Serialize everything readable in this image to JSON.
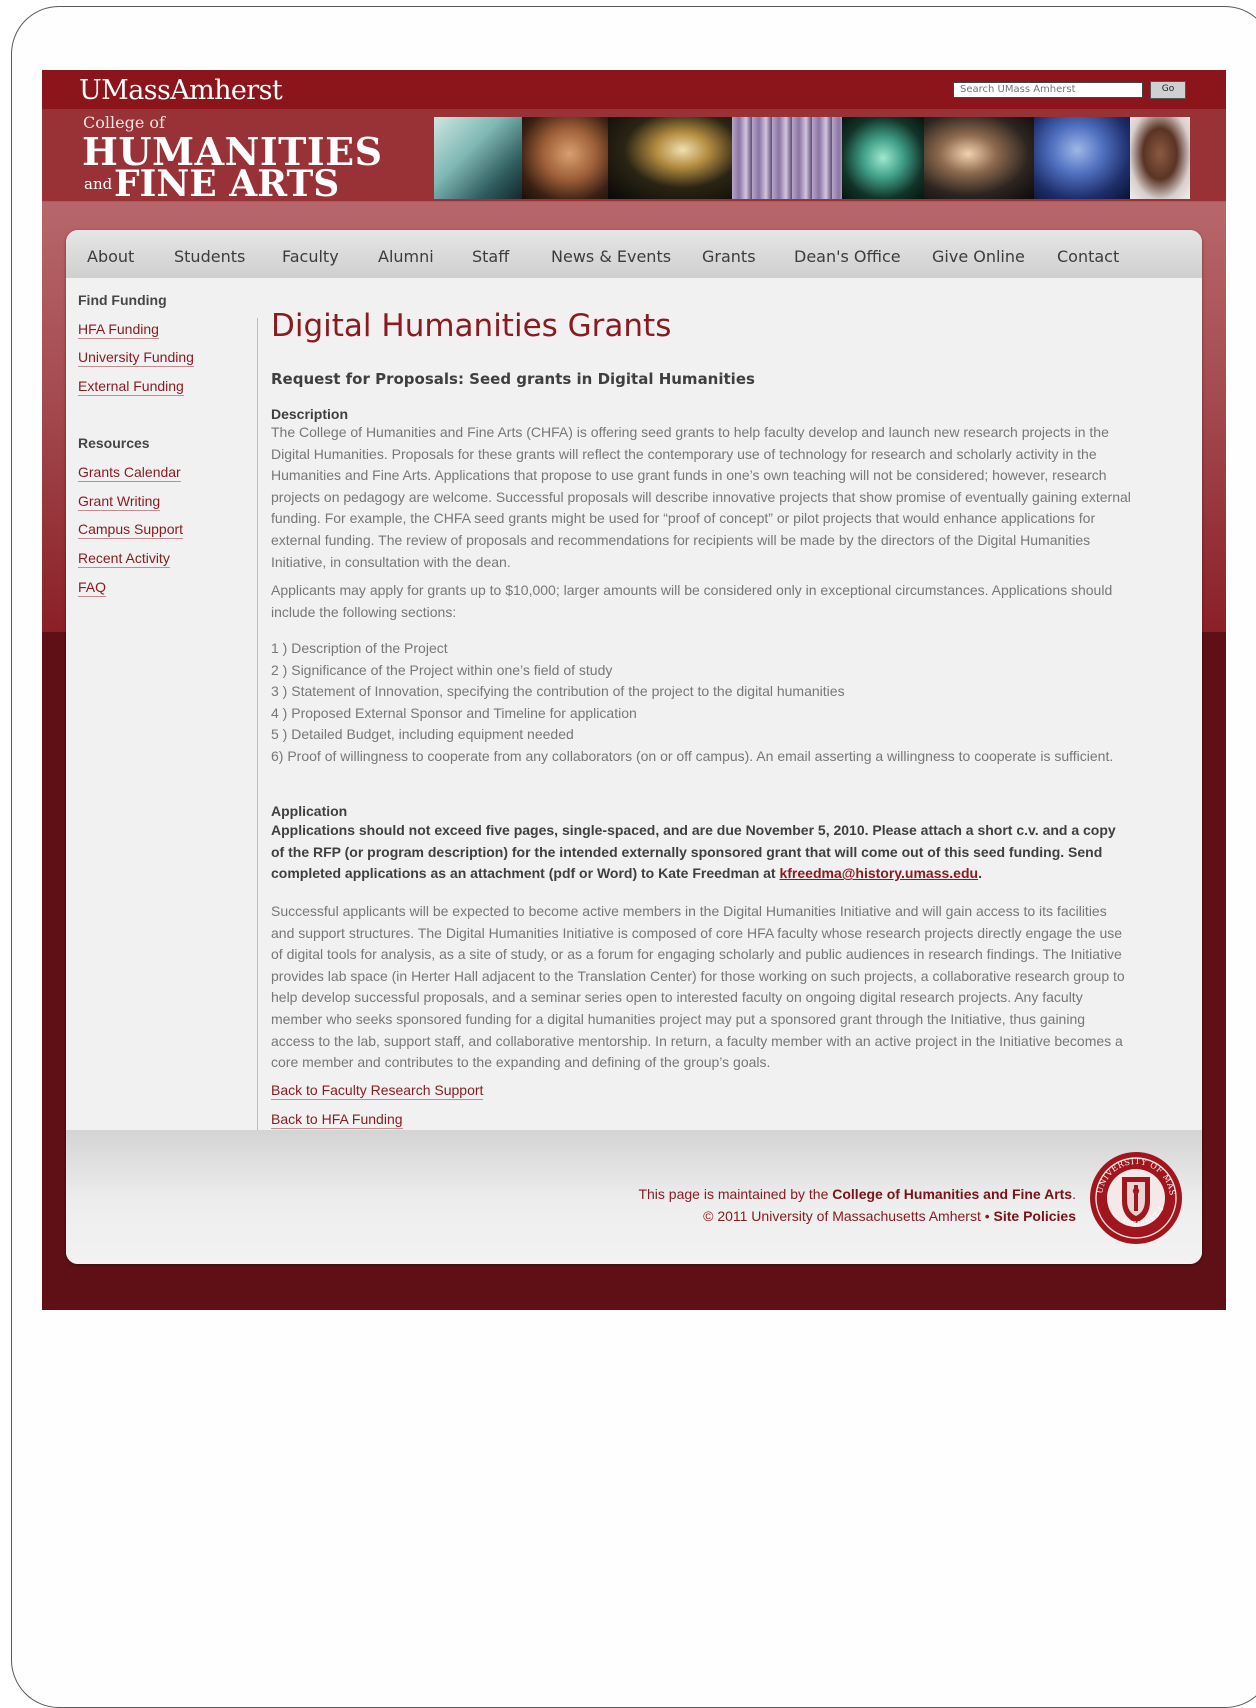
{
  "header": {
    "brand": "UMassAmherst",
    "search_placeholder": "Search UMass Amherst",
    "search_button": "Go",
    "college_of": "College of",
    "humanities": "HUMANITIES",
    "and_word": "and",
    "fine_arts": "FINE ARTS"
  },
  "nav": {
    "items": [
      "About",
      "Students",
      "Faculty",
      "Alumni",
      "Staff",
      "News & Events",
      "Grants",
      "Dean's Office",
      "Give Online",
      "Contact"
    ]
  },
  "sidebar": {
    "sections": [
      {
        "heading": "Find Funding",
        "links": [
          "HFA Funding",
          "University Funding",
          "External Funding"
        ]
      },
      {
        "heading": "Resources",
        "links": [
          "Grants Calendar",
          "Grant Writing",
          "Campus Support",
          "Recent Activity",
          "FAQ"
        ]
      }
    ]
  },
  "main": {
    "title": "Digital Humanities Grants",
    "subtitle": "Request for Proposals: Seed grants in Digital Humanities",
    "description_heading": "Description",
    "description": "The College of Humanities and Fine Arts (CHFA) is offering seed grants to help faculty develop and launch new research projects in the Digital Humanities. Proposals for these grants will reflect the contemporary use of technology for research and scholarly activity in the Humanities and Fine Arts. Applications that propose to use grant funds in one’s own teaching will not be considered; however, research projects on pedagogy are welcome. Successful proposals will describe innovative projects that show promise of eventually gaining external funding. For example, the CHFA seed grants might be used for “proof of concept” or pilot projects that would enhance applications for external funding. The review of proposals and recommendations for recipients will be made by the directors of the Digital Humanities Initiative, in consultation with the dean.",
    "amount": "Applicants may apply for grants up to $10,000; larger amounts will be considered only in exceptional circumstances. Applications should include the following sections:",
    "sections_list": [
      "1 ) Description of the Project",
      "2 ) Significance of the Project within one’s field of study",
      "3 ) Statement of Innovation, specifying the contribution of the project to the digital humanities",
      "4 ) Proposed External Sponsor and Timeline for application",
      "5 ) Detailed Budget, including equipment needed",
      "6) Proof of willingness to cooperate from any collaborators (on or off campus). An email asserting a willingness to cooperate is sufficient."
    ],
    "application_heading": "Application",
    "application_text": "Applications should not exceed five pages, single-spaced, and are due November 5, 2010. Please attach a short c.v. and a copy of the RFP (or program description) for the intended externally sponsored grant that will come out of this seed funding. Send completed applications as an attachment (pdf or Word) to Kate Freedman at ",
    "application_email": "kfreedma@history.umass.edu",
    "application_end": ".",
    "closing": "Successful applicants will be expected to become active members in the Digital Humanities Initiative and will gain access to its facilities and support structures. The Digital Humanities Initiative is composed of core HFA faculty whose research projects directly engage the use of digital tools for analysis, as a site of study, or as a forum for engaging scholarly and public audiences in research findings. The Initiative provides lab space (in Herter Hall adjacent to the Translation Center) for those working on such projects, a collaborative research group to help develop successful proposals, and a seminar series open to interested faculty on ongoing digital research projects. Any faculty member who seeks sponsored funding for a digital humanities project may put a sponsored grant through the Initiative, thus gaining access to the lab, support staff, and collaborative mentorship. In return, a faculty member with an active project in the Initiative becomes a core member and contributes to the expanding and defining of the group’s goals.",
    "back_link_1": "Back to Faculty Research Support",
    "back_link_2": "Back to HFA Funding"
  },
  "footer": {
    "maintained_prefix": "This page is maintained by the ",
    "maintained_org": "College of Humanities and Fine Arts",
    "maintained_suffix": ".",
    "copyright": "© 2011 University of Massachusetts Amherst • ",
    "policies": "Site Policies",
    "seal_text": "UNIVERSITY OF MASSACHUSETTS AMHERST 1863"
  },
  "colors": {
    "maroon_dark": "#5e1016",
    "maroon": "#8c141b",
    "title_red": "#8a1a1e",
    "panel": "#f1f1f2"
  }
}
